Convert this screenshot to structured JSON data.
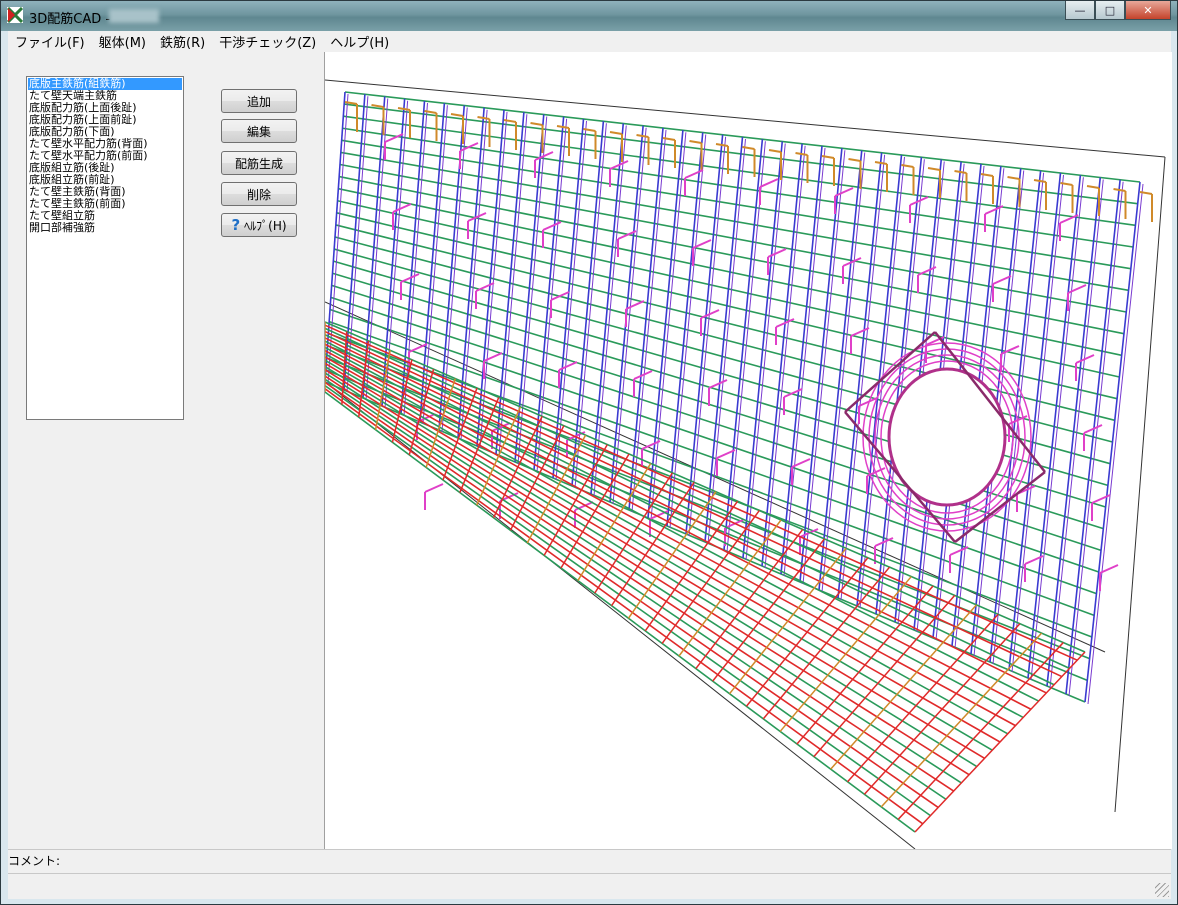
{
  "window": {
    "title": "3D配筋CAD -",
    "controls": {
      "minimize": "—",
      "maximize": "□",
      "close": "✕"
    }
  },
  "menu": [
    {
      "label": "ファイル(F)"
    },
    {
      "label": "躯体(M)"
    },
    {
      "label": "鉄筋(R)"
    },
    {
      "label": "干渉チェック(Z)"
    },
    {
      "label": "ヘルプ(H)"
    }
  ],
  "rebar_list": {
    "selected_index": 0,
    "items": [
      "底版主鉄筋(組鉄筋)",
      "たて壁天端主鉄筋",
      "底版配力筋(上面後趾)",
      "底版配力筋(上面前趾)",
      "底版配力筋(下面)",
      "たて壁水平配力筋(背面)",
      "たて壁水平配力筋(前面)",
      "底版組立筋(後趾)",
      "底版組立筋(前趾)",
      "たて壁主鉄筋(背面)",
      "たて壁主鉄筋(前面)",
      "たて壁組立筋",
      "開口部補強筋"
    ]
  },
  "buttons": {
    "add": "追加",
    "edit": "編集",
    "generate": "配筋生成",
    "delete": "削除",
    "help": "ﾍﾙﾌﾟ(H)"
  },
  "comment_label": "コメント:",
  "colors": {
    "vertical_rebar": "#3a3ad0",
    "horizontal_rebar": "#2a9a5a",
    "hook_rebar": "#e040c8",
    "base_rebar": "#e02a2a",
    "top_rebar": "#d08a2a"
  }
}
